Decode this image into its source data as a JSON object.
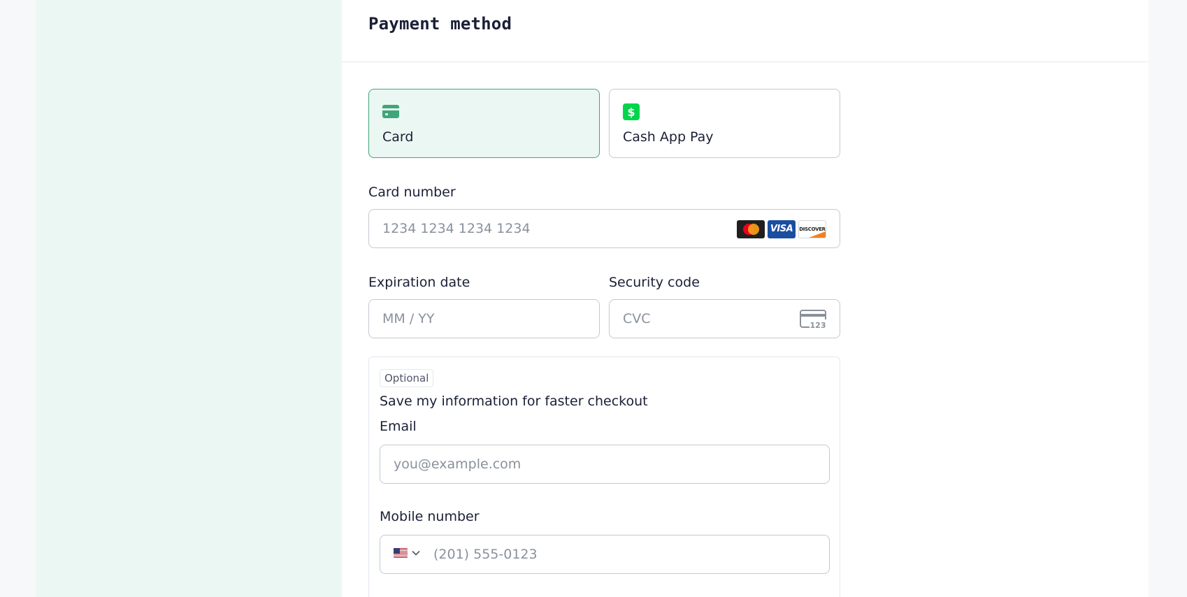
{
  "header": {
    "title": "Payment method"
  },
  "tabs": [
    {
      "label": "Card",
      "icon": "credit-card-icon",
      "active": true
    },
    {
      "label": "Cash App Pay",
      "icon": "cash-app-icon",
      "active": false
    }
  ],
  "card_number": {
    "label": "Card number",
    "placeholder": "1234 1234 1234 1234",
    "brands": [
      "mastercard-icon",
      "visa-icon",
      "discover-icon"
    ],
    "visa_text": "VISA",
    "discover_text": "DISCOVER"
  },
  "expiration": {
    "label": "Expiration date",
    "placeholder": "MM / YY"
  },
  "security": {
    "label": "Security code",
    "placeholder": "CVC",
    "icon_text": "123"
  },
  "save_info": {
    "badge": "Optional",
    "text": "Save my information for faster checkout",
    "email": {
      "label": "Email",
      "placeholder": "you@example.com"
    },
    "phone": {
      "label": "Mobile number",
      "placeholder": "(201) 555-0123",
      "country": "us-flag-icon"
    }
  },
  "colors": {
    "accent": "#3fa67a",
    "accent_bg": "#ebf7f2",
    "cash_app_green": "#00d54b"
  }
}
